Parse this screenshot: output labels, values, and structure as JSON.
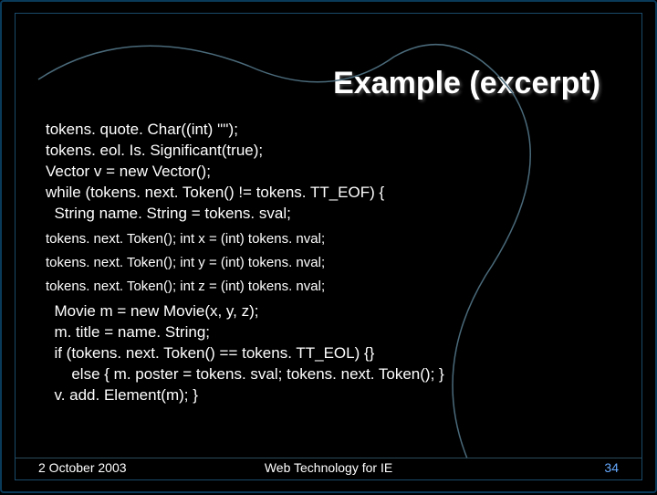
{
  "title": "Example (excerpt)",
  "code": {
    "l1": "tokens. quote. Char((int) '\"');",
    "l2": "tokens. eol. Is. Significant(true);",
    "l3": "Vector v = new Vector();",
    "l4": "while (tokens. next. Token() != tokens. TT_EOF) {",
    "l5": "  String name. String = tokens. sval;",
    "l6": "tokens. next. Token(); int x = (int) tokens. nval;",
    "l7": "tokens. next. Token(); int y = (int) tokens. nval;",
    "l8": "tokens. next. Token(); int z = (int) tokens. nval;",
    "l9": "  Movie m = new Movie(x, y, z);",
    "l10": "  m. title = name. String;",
    "l11": "  if (tokens. next. Token() == tokens. TT_EOL) {}",
    "l12": "      else { m. poster = tokens. sval; tokens. next. Token(); }",
    "l13": "  v. add. Element(m); }"
  },
  "footer": {
    "date": "2 October 2003",
    "center": "Web Technology for IE",
    "page": "34"
  }
}
